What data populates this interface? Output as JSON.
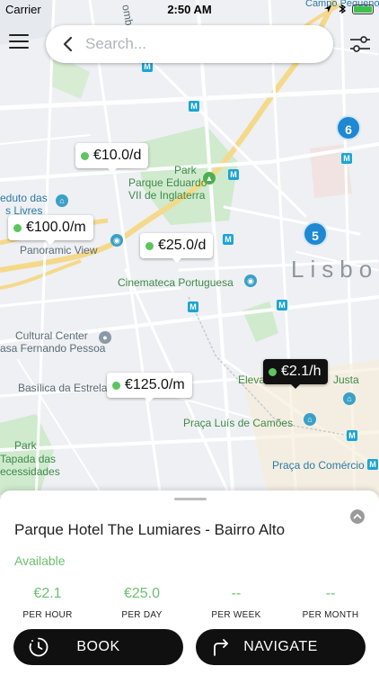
{
  "status_bar": {
    "carrier": "Carrier",
    "time": "2:50 AM"
  },
  "search": {
    "placeholder": "Search..."
  },
  "map": {
    "labels": {
      "parque_eduardo_1": "Park",
      "parque_eduardo_2": "Parque Eduardo",
      "parque_eduardo_3": "VII de Inglaterra",
      "aqueduto_1": "eduto das",
      "aqueduto_2": "s Livres",
      "panoramic": "Panoramic View",
      "cinemateca": "Cinemateca Portuguesa",
      "lisboa": "Lisbo",
      "cultural_1": "Cultural Center",
      "cultural_2": "asa Fernando Pessoa",
      "basilica": "Basílica da Estrela",
      "elevador": "Eleva",
      "justa": "Justa",
      "camoes": "Praça Luís de Camões",
      "park2_1": "Park",
      "park2_2": "Tapada das",
      "park2_3": "ecessidades",
      "comercio": "Praça do Comércio",
      "campo": "Campo Pequeno",
      "combatentes": "ombate"
    },
    "clusters": [
      "6",
      "5"
    ],
    "price_tags": [
      "€10.0/d",
      "€100.0/m",
      "€25.0/d",
      "€125.0/m",
      "€2.1/h"
    ]
  },
  "sheet": {
    "title": "Parque Hotel The Lumiares - Bairro Alto",
    "availability": "Available",
    "rates": [
      {
        "value": "€2.1",
        "label": "PER HOUR"
      },
      {
        "value": "€25.0",
        "label": "PER DAY"
      },
      {
        "value": "--",
        "label": "PER WEEK"
      },
      {
        "value": "--",
        "label": "PER MONTH"
      }
    ],
    "book_label": "BOOK",
    "navigate_label": "NAVIGATE"
  }
}
